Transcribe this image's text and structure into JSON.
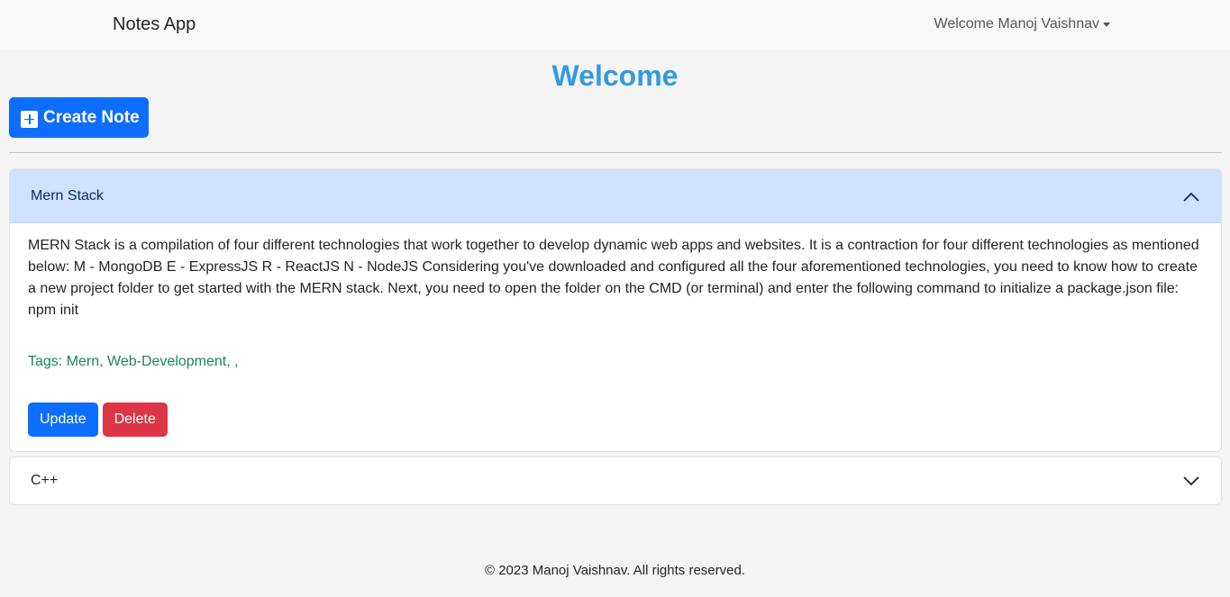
{
  "navbar": {
    "brand": "Notes App",
    "user_menu_label": "Welcome Manoj Vaishnav"
  },
  "page": {
    "title": "Welcome",
    "create_button_label": "Create Note"
  },
  "notes": [
    {
      "title": "Mern Stack",
      "expanded": true,
      "content": "MERN Stack is a compilation of four different technologies that work together to develop dynamic web apps and websites. It is a contraction for four different technologies as mentioned below: M - MongoDB E - ExpressJS R - ReactJS N - NodeJS Considering you've downloaded and configured all the four aforementioned technologies, you need to know how to create a new project folder to get started with the MERN stack. Next, you need to open the folder on the CMD (or terminal) and enter the following command to initialize a package.json file: npm init",
      "tags": "Tags: Mern, Web-Development, ,",
      "update_label": "Update",
      "delete_label": "Delete"
    },
    {
      "title": "C++",
      "expanded": false
    }
  ],
  "footer": {
    "text": "© 2023 Manoj Vaishnav. All rights reserved."
  },
  "icons": {
    "create": "plus-square-icon",
    "expanded": "chevron-up-icon",
    "collapsed": "chevron-down-icon",
    "user_menu": "caret-down-icon"
  },
  "colors": {
    "primary": "#0d6efd",
    "danger": "#dc3545",
    "title": "#339ae0",
    "tags": "#198754",
    "accordion_active_bg": "#cfe2ff"
  }
}
